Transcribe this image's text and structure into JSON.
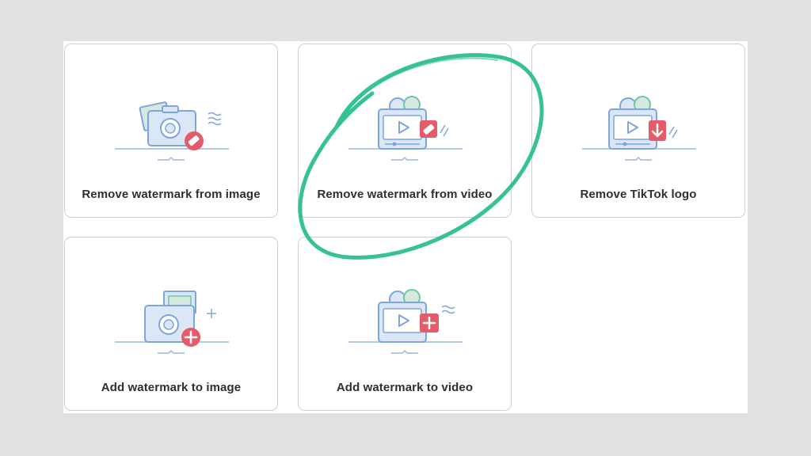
{
  "cards": [
    {
      "label": "Remove watermark from image",
      "icon": "camera-eraser-icon"
    },
    {
      "label": "Remove watermark from video",
      "icon": "video-eraser-icon"
    },
    {
      "label": "Remove TikTok logo",
      "icon": "video-download-icon"
    },
    {
      "label": "Add watermark to image",
      "icon": "camera-add-icon"
    },
    {
      "label": "Add watermark to video",
      "icon": "video-add-icon"
    }
  ],
  "colors": {
    "highlight": "#2bbf8e",
    "icon_blue": "#7fa6db",
    "icon_blue_fill": "#dbe7f7",
    "icon_red": "#e45c6a",
    "icon_green": "#6fc7a5",
    "card_border": "#cfcfcf"
  }
}
